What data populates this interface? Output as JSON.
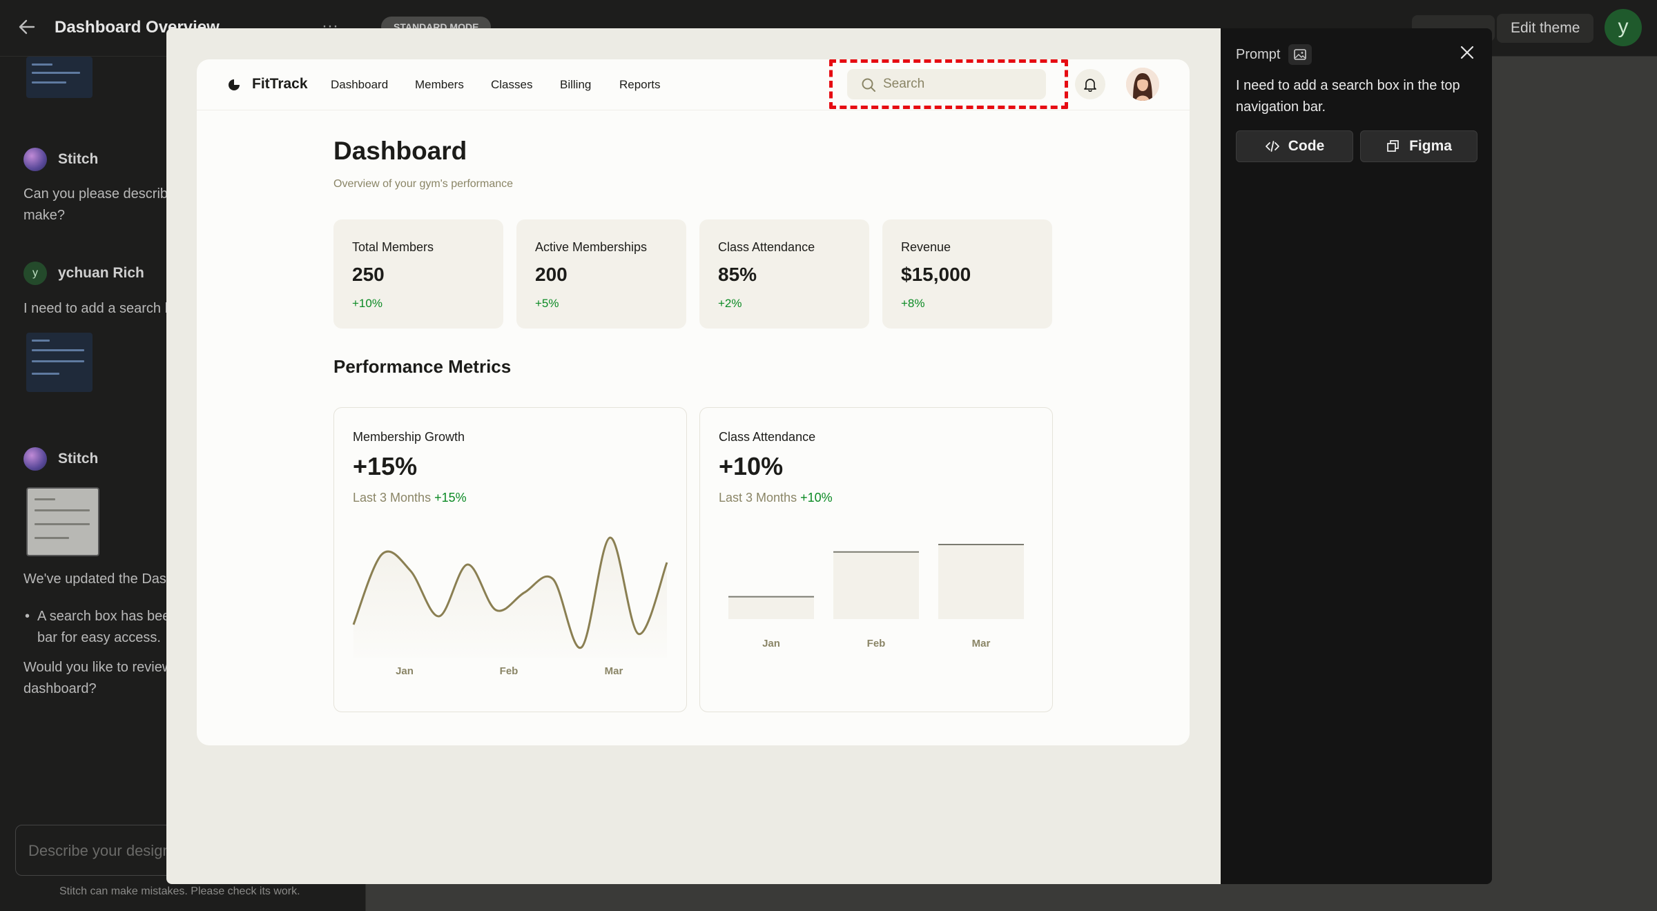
{
  "background": {
    "title": "Dashboard Overview",
    "mode_badge": "STANDARD MODE",
    "edit_theme_label": "Edit theme",
    "user_initial": "y",
    "chat": [
      {
        "author": "Stitch",
        "text": "Can you please describe the changes you'd like to make?"
      },
      {
        "author": "ychuan Rich",
        "initial": "y",
        "text": "I need to add a search box in the top navigation bar."
      },
      {
        "author": "Stitch",
        "text": "We've updated the Dashboard Overview.",
        "bullet": "A search box has been added to the top navigation bar for easy access.",
        "followup": "Would you like to review other features of the dashboard?"
      }
    ],
    "input_placeholder": "Describe your design",
    "disclaimer": "Stitch can make mistakes. Please check its work."
  },
  "app": {
    "brand": "FitTrack",
    "nav_links": [
      "Dashboard",
      "Members",
      "Classes",
      "Billing",
      "Reports"
    ],
    "search_placeholder": "Search",
    "page_title": "Dashboard",
    "page_subtitle": "Overview of your gym's performance",
    "stats": [
      {
        "label": "Total Members",
        "value": "250",
        "change": "+10%"
      },
      {
        "label": "Active Memberships",
        "value": "200",
        "change": "+5%"
      },
      {
        "label": "Class Attendance",
        "value": "85%",
        "change": "+2%"
      },
      {
        "label": "Revenue",
        "value": "$15,000",
        "change": "+8%"
      }
    ],
    "section_title": "Performance Metrics",
    "charts": [
      {
        "title": "Membership Growth",
        "value": "+15%",
        "period": "Last 3 Months",
        "period_change": "+15%"
      },
      {
        "title": "Class Attendance",
        "value": "+10%",
        "period": "Last 3 Months",
        "period_change": "+10%"
      }
    ]
  },
  "chart_data": [
    {
      "type": "line",
      "title": "Membership Growth",
      "x": [
        "Jan",
        "Feb",
        "Mar"
      ],
      "series": [
        {
          "values": [
            0.14,
            0.82,
            0.66,
            0.22,
            0.72,
            0.28,
            0.45,
            0.58,
            -0.08,
            0.98,
            0.05,
            0.74
          ]
        }
      ],
      "grid": false,
      "colors": {
        "line": "#8a7f52",
        "fill": "#f3f1ea"
      }
    },
    {
      "type": "bar",
      "title": "Class Attendance",
      "categories": [
        "Jan",
        "Feb",
        "Mar"
      ],
      "values": [
        0.3,
        0.9,
        1.0
      ],
      "grid": false,
      "colors": {
        "bar": "#f3f1ea",
        "cap": "#7a7a70"
      }
    }
  ],
  "prompt_panel": {
    "label": "Prompt",
    "text": "I need to add a search box in the top navigation bar.",
    "code_label": "Code",
    "figma_label": "Figma"
  },
  "colors": {
    "accent_green": "#0b8a24",
    "muted_text": "#8a8566",
    "highlight_red": "#e60c12"
  }
}
